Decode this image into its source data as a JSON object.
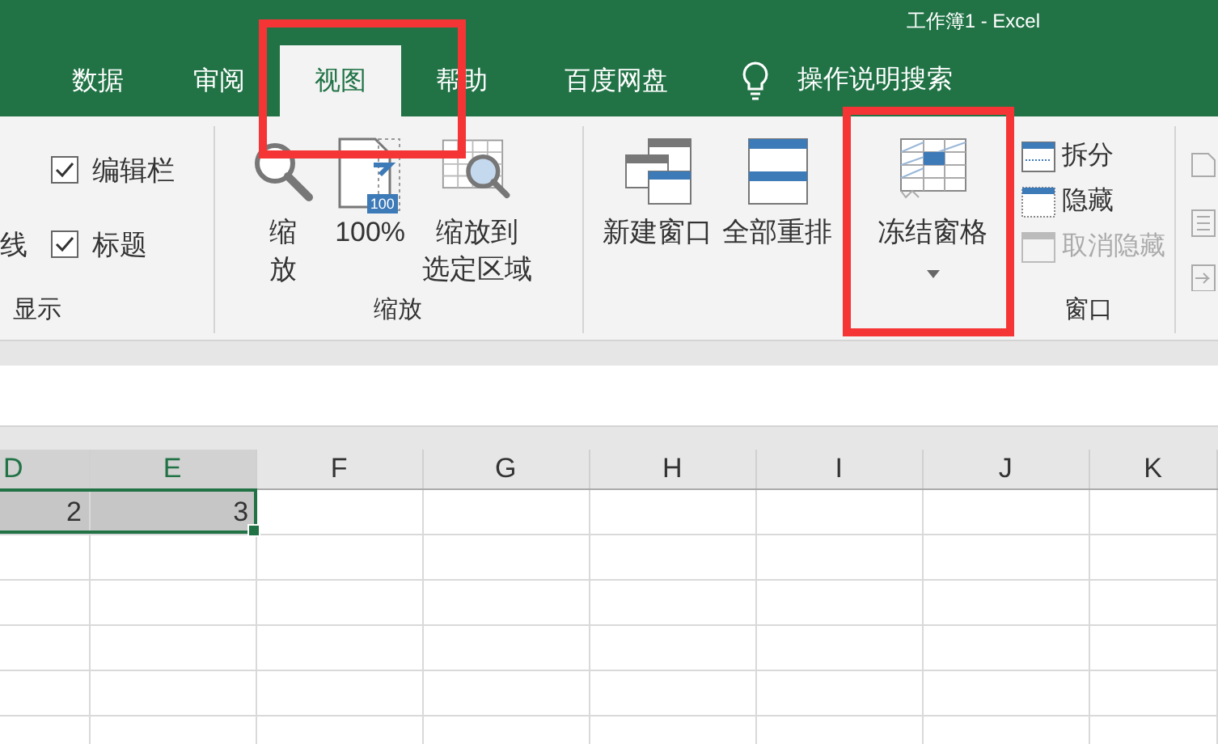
{
  "window": {
    "title": "工作簿1 - Excel"
  },
  "tabs": [
    {
      "label": "数据",
      "selected": false
    },
    {
      "label": "审阅",
      "selected": false
    },
    {
      "label": "视图",
      "selected": true
    },
    {
      "label": "帮助",
      "selected": false
    },
    {
      "label": "百度网盘",
      "selected": false
    }
  ],
  "tell_me": {
    "label": "操作说明搜索"
  },
  "display_group": {
    "cut_label": "线",
    "checkboxes": [
      {
        "label": "编辑栏",
        "checked": true
      },
      {
        "label": "标题",
        "checked": true
      }
    ],
    "label": "显示"
  },
  "zoom_group": {
    "buttons": [
      {
        "kind": "zoom",
        "lines": [
          "缩",
          "放"
        ]
      },
      {
        "kind": "hundred",
        "badge": "100",
        "lines": [
          "100%"
        ]
      },
      {
        "kind": "selection",
        "lines": [
          "缩放到",
          "选定区域"
        ]
      }
    ],
    "label": "缩放"
  },
  "window_group": {
    "buttons": [
      {
        "kind": "new-window",
        "label": "新建窗口",
        "dropdown": false
      },
      {
        "kind": "arrange",
        "label": "全部重排",
        "dropdown": false
      },
      {
        "kind": "freeze",
        "label": "冻结窗格",
        "dropdown": true
      }
    ],
    "small_buttons": [
      {
        "kind": "split",
        "label": "拆分",
        "disabled": false
      },
      {
        "kind": "hide",
        "label": "隐藏",
        "disabled": false
      },
      {
        "kind": "unhide",
        "label": "取消隐藏",
        "disabled": true
      }
    ],
    "label": "窗口"
  },
  "sheet": {
    "columns": [
      {
        "label": "D",
        "selected": true
      },
      {
        "label": "E",
        "selected": true
      },
      {
        "label": "F",
        "selected": false
      },
      {
        "label": "G",
        "selected": false
      },
      {
        "label": "H",
        "selected": false
      },
      {
        "label": "I",
        "selected": false
      },
      {
        "label": "J",
        "selected": false
      },
      {
        "label": "K",
        "selected": false
      }
    ],
    "rows": [
      {
        "values": [
          "2",
          "3"
        ]
      }
    ]
  }
}
